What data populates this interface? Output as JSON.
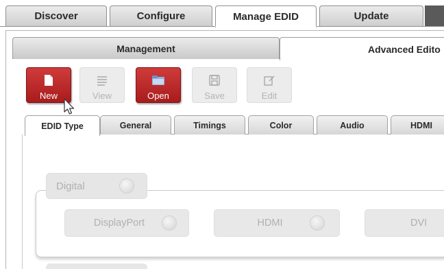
{
  "top_tabs": [
    {
      "label": "Discover"
    },
    {
      "label": "Configure"
    },
    {
      "label": "Manage EDID"
    },
    {
      "label": "Update"
    }
  ],
  "sub_tabs": [
    {
      "label": "Management"
    },
    {
      "label": "Advanced Edito"
    }
  ],
  "toolbar": [
    {
      "label": "New",
      "icon": "document-icon",
      "enabled": true
    },
    {
      "label": "View",
      "icon": "list-icon",
      "enabled": false
    },
    {
      "label": "Open",
      "icon": "folder-icon",
      "enabled": true
    },
    {
      "label": "Save",
      "icon": "floppy-icon",
      "enabled": false
    },
    {
      "label": "Edit",
      "icon": "pencil-icon",
      "enabled": false
    }
  ],
  "editor_tabs": [
    {
      "label": "EDID Type"
    },
    {
      "label": "General"
    },
    {
      "label": "Timings"
    },
    {
      "label": "Color"
    },
    {
      "label": "Audio"
    },
    {
      "label": "HDMI"
    }
  ],
  "digital": {
    "label": "Digital",
    "options": [
      {
        "label": "DisplayPort"
      },
      {
        "label": "HDMI"
      },
      {
        "label": "DVI"
      }
    ]
  },
  "colors": {
    "accent_red": "#b82626",
    "disabled_text": "#b0b0b0"
  }
}
